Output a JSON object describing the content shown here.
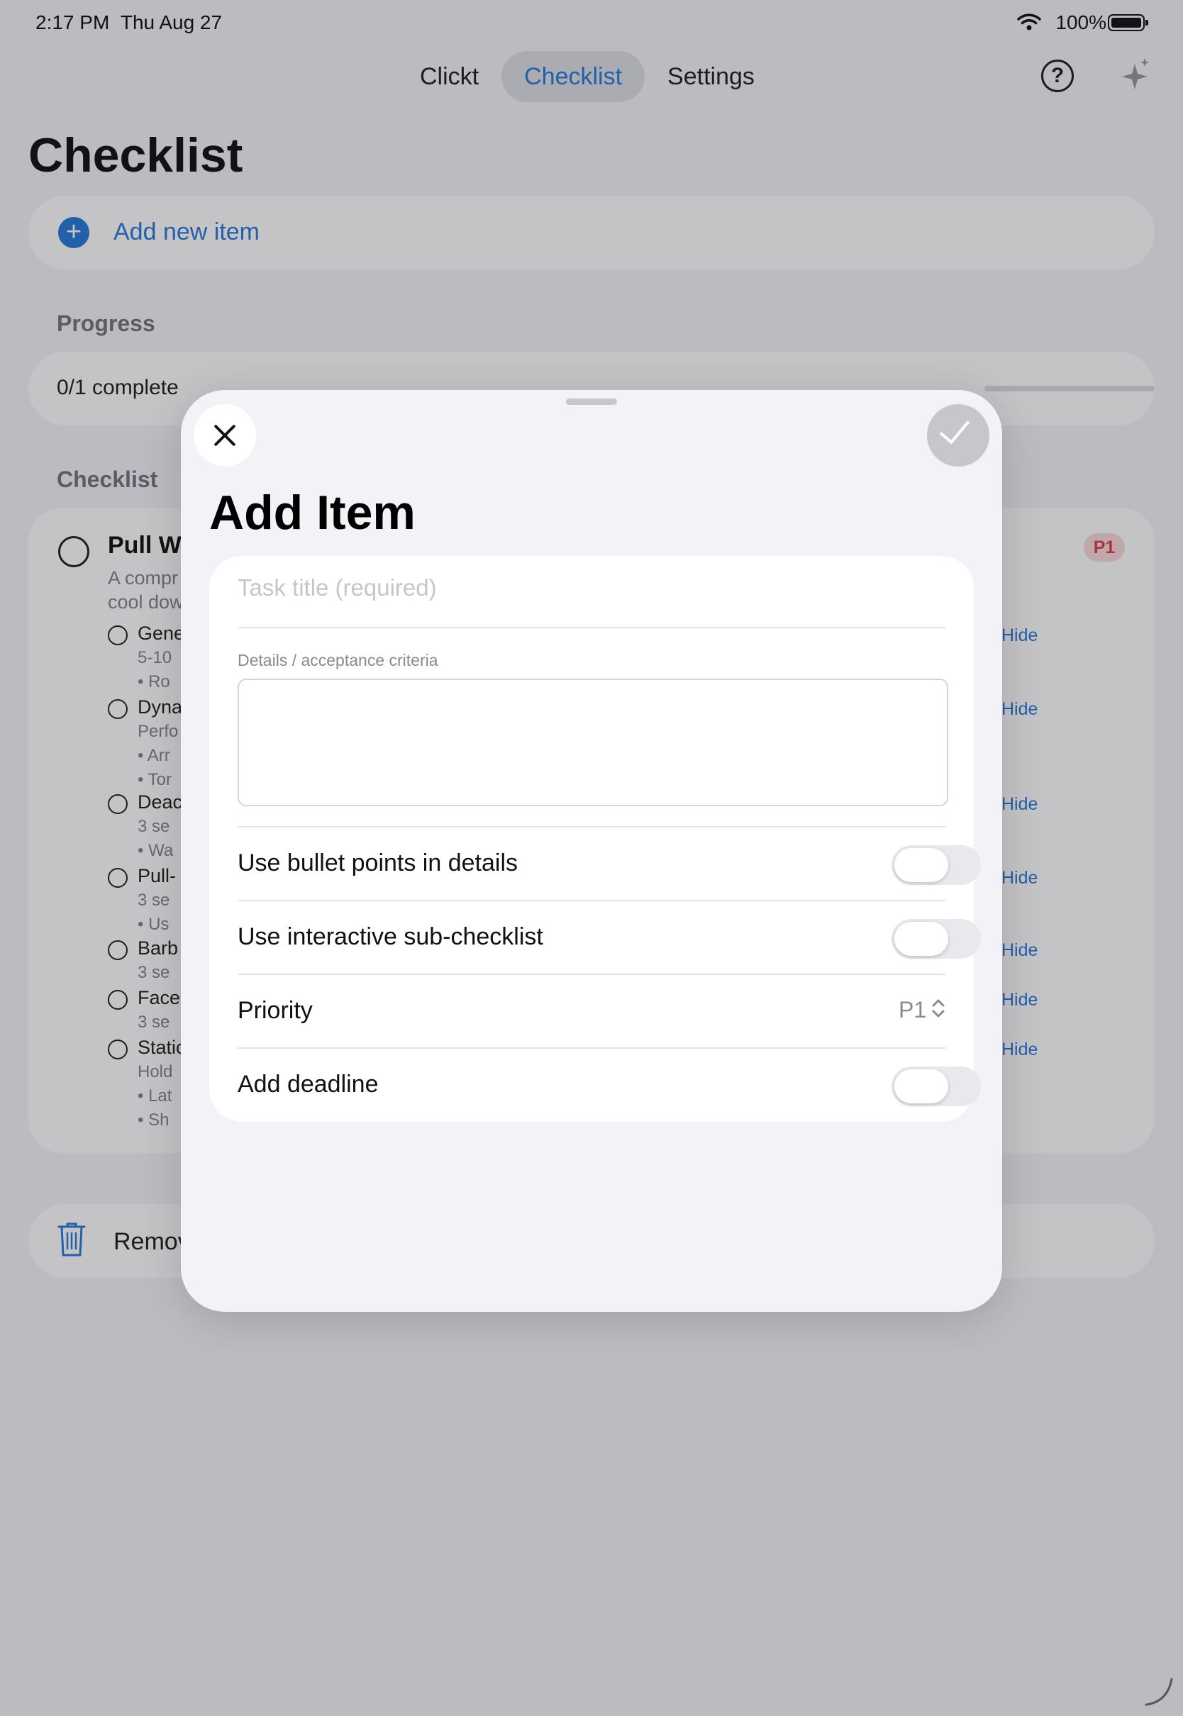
{
  "status_bar": {
    "time": "2:17 PM",
    "date": "Thu Aug 27",
    "battery": "100%"
  },
  "tabs": [
    {
      "label": "Clickt"
    },
    {
      "label": "Checklist"
    },
    {
      "label": "Settings"
    }
  ],
  "icons": {
    "help": "question-circle-icon",
    "assistant": "sparkles-icon"
  },
  "page": {
    "title": "Checklist",
    "add_item_label": "Add new item",
    "progress_heading": "Progress",
    "progress_text": "0/1 complete",
    "progress_fraction": 0,
    "checklist_heading": "Checklist",
    "remove_label": "Remov"
  },
  "checklist_item": {
    "title": "Pull We",
    "badge": "P1",
    "desc_lines": [
      "A compr",
      "cool dow"
    ],
    "subitems": [
      {
        "title": "Gene",
        "lines": [
          "5-10",
          "• Ro"
        ],
        "hide": "Hide"
      },
      {
        "title": "Dyna",
        "lines": [
          "Perfo",
          "• Arr",
          "• Tor"
        ],
        "hide": "Hide"
      },
      {
        "title": "Deac",
        "lines": [
          "3 se",
          "• Wa"
        ],
        "hide": "Hide"
      },
      {
        "title": "Pull-",
        "lines": [
          "3 se",
          "• Us"
        ],
        "hide": "Hide"
      },
      {
        "title": "Barb",
        "lines": [
          "3 se"
        ],
        "hide": "Hide"
      },
      {
        "title": "Face",
        "lines": [
          "3 se"
        ],
        "hide": "Hide"
      },
      {
        "title": "Static",
        "lines": [
          "Hold",
          "• Lat",
          "• Sh"
        ],
        "hide": "Hide"
      }
    ]
  },
  "sheet": {
    "title": "Add Item",
    "close_icon": "xmark-icon",
    "confirm_icon": "checkmark-icon",
    "task_title_placeholder": "Task title (required)",
    "details_label": "Details / acceptance criteria",
    "details_value": "",
    "bullet_points_label": "Use bullet points in details",
    "bullet_points_on": false,
    "sub_checklist_label": "Use interactive sub-checklist",
    "sub_checklist_on": false,
    "priority_label": "Priority",
    "priority_value": "P1",
    "deadline_label": "Add deadline",
    "deadline_on": false
  },
  "colors": {
    "accent": "#1a6fd6",
    "badge_bg": "#f8d6d6",
    "badge_text": "#d43434",
    "sheet_bg": "#f2f2f7"
  }
}
